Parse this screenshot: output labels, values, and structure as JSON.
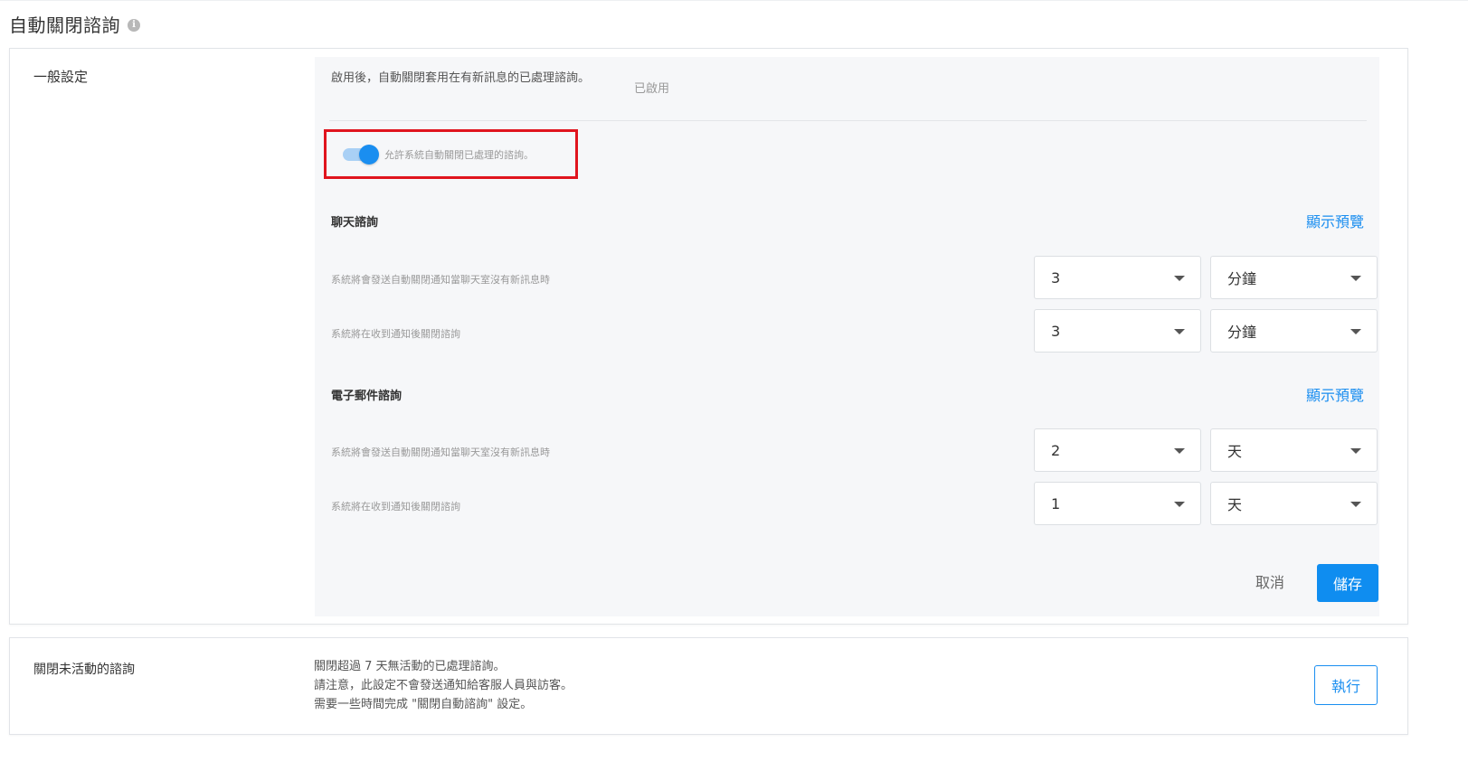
{
  "page": {
    "title": "自動關閉諮詢",
    "info_icon": "i"
  },
  "general": {
    "label": "一般設定",
    "description": "啟用後，自動關閉套用在有新訊息的已處理諮詢。",
    "status": "已啟用",
    "toggle_label": "允許系統自動關閉已處理的諮詢。",
    "toggle_on": true,
    "chat": {
      "title": "聊天諮詢",
      "preview_link": "顯示預覽",
      "rows": [
        {
          "text": "系統將會發送自動關閉通知當聊天室沒有新訊息時",
          "number": "3",
          "unit": "分鐘"
        },
        {
          "text": "系統將在收到通知後關閉諮詢",
          "number": "3",
          "unit": "分鐘"
        }
      ]
    },
    "email": {
      "title": "電子郵件諮詢",
      "preview_link": "顯示預覽",
      "rows": [
        {
          "text": "系統將會發送自動關閉通知當聊天室沒有新訊息時",
          "number": "2",
          "unit": "天"
        },
        {
          "text": "系統將在收到通知後關閉諮詢",
          "number": "1",
          "unit": "天"
        }
      ]
    },
    "cancel_label": "取消",
    "save_label": "儲存"
  },
  "close_inactive": {
    "label": "關閉未活動的諮詢",
    "lines": [
      "關閉超過 7 天無活動的已處理諮詢。",
      "請注意，此設定不會發送通知給客服人員與訪客。",
      "需要一些時間完成 \"關閉自動諮詢\" 設定。"
    ],
    "run_label": "執行"
  },
  "colors": {
    "accent": "#1a8ef0",
    "highlight_border": "#e0141e",
    "panel_bg": "#f6f7f9"
  }
}
